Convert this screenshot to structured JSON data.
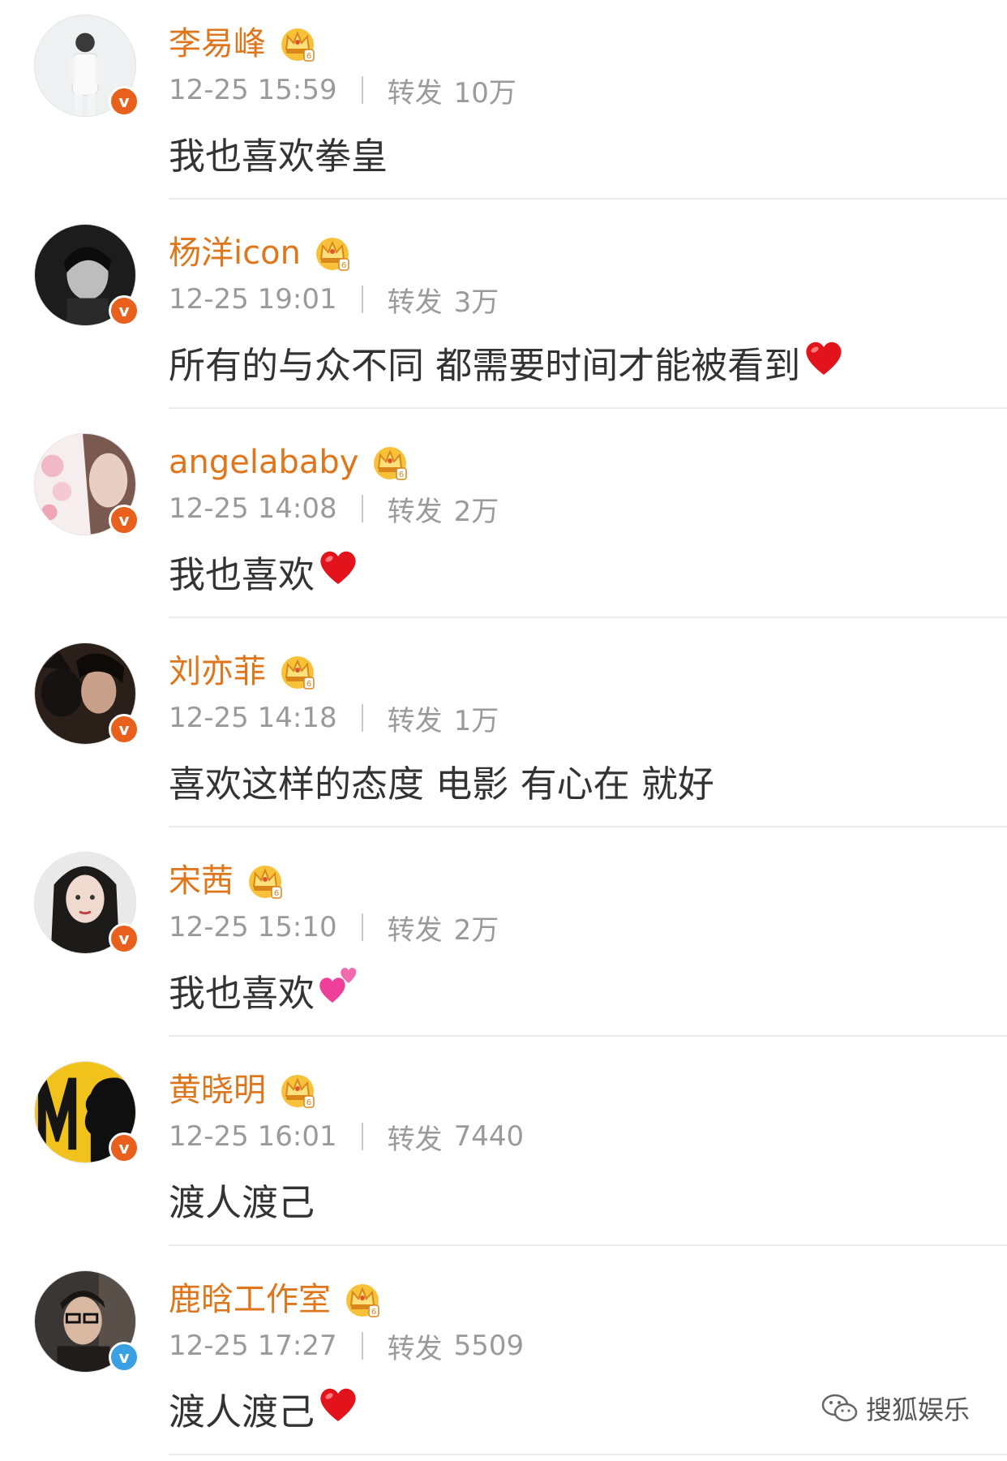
{
  "colors": {
    "name": "#e0761c",
    "meta": "#9a9a9a",
    "text": "#333333",
    "badge_orange": "#e8601c",
    "badge_blue": "#3aa0e4"
  },
  "repost_label": "转发",
  "comments": [
    {
      "name": "李易峰",
      "time": "12-25 15:59",
      "repost": "10万",
      "text": "我也喜欢拳皇",
      "emoji": "",
      "badge": "orange"
    },
    {
      "name": "杨洋icon",
      "time": "12-25 19:01",
      "repost": "3万",
      "text": "所有的与众不同 都需要时间才能被看到",
      "emoji": "heart-icon",
      "badge": "orange"
    },
    {
      "name": "angelababy",
      "time": "12-25 14:08",
      "repost": "2万",
      "text": "我也喜欢",
      "emoji": "heart-icon",
      "badge": "orange"
    },
    {
      "name": "刘亦菲",
      "time": "12-25 14:18",
      "repost": "1万",
      "text": "喜欢这样的态度 电影 有心在 就好",
      "emoji": "",
      "badge": "orange"
    },
    {
      "name": "宋茜",
      "time": "12-25 15:10",
      "repost": "2万",
      "text": "我也喜欢",
      "emoji": "two-hearts-icon",
      "badge": "orange"
    },
    {
      "name": "黄晓明",
      "time": "12-25 16:01",
      "repost": "7440",
      "text": "渡人渡己",
      "emoji": "",
      "badge": "orange"
    },
    {
      "name": "鹿晗工作室",
      "time": "12-25 17:27",
      "repost": "5509",
      "text": "渡人渡己",
      "emoji": "heart-icon",
      "badge": "blue"
    }
  ],
  "watermark": {
    "text": "搜狐娱乐",
    "icon": "wechat-icon"
  }
}
